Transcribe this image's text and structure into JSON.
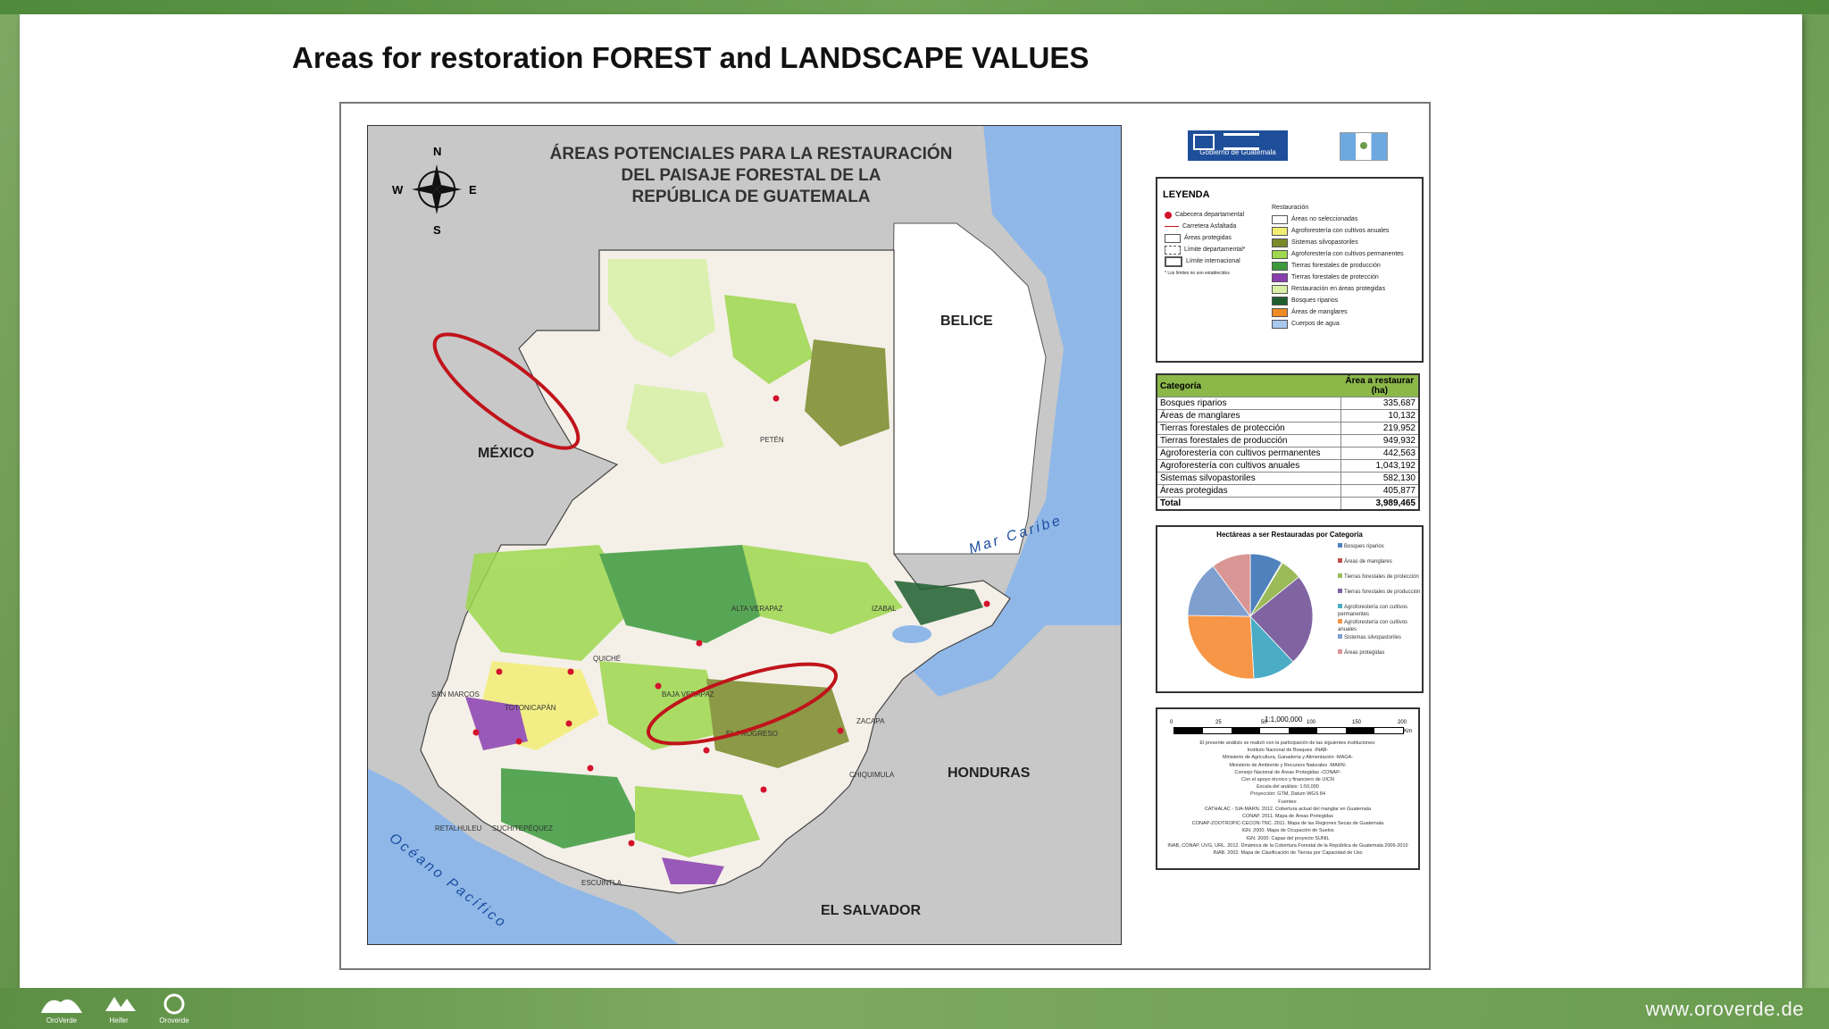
{
  "slide": {
    "title": "Areas for restoration FOREST and LANDSCAPE VALUES",
    "footer_url": "www.oroverde.de"
  },
  "map": {
    "title_lines": [
      "ÁREAS POTENCIALES PARA LA RESTAURACIÓN",
      "DEL PAISAJE FORESTAL DE LA",
      "REPÚBLICA DE GUATEMALA"
    ],
    "compass": {
      "n": "N",
      "s": "S",
      "e": "E",
      "w": "W"
    },
    "country_labels": {
      "mexico": "MÉXICO",
      "belice": "BELICE",
      "honduras": "HONDURAS",
      "el_salvador": "EL SALVADOR"
    },
    "sea_labels": {
      "caribe": "Mar Caribe",
      "pacifico": "Océano Pacífico"
    },
    "department_labels": {
      "peten": "PETÉN",
      "alta_verapaz": "ALTA VERAPAZ",
      "izabal": "IZABAL",
      "quiche": "QUICHÉ",
      "baja_verapaz": "BAJA VERAPAZ",
      "el_progreso": "EL PROGRESO",
      "zacapa": "ZACAPA",
      "san_marcos": "SAN MARCOS",
      "totonicapan": "TOTONICAPÁN",
      "escuintla": "ESCUINTLA",
      "retalhuleu": "RETALHULEU",
      "suchitepequez": "SUCHITEPÉQUEZ",
      "chiquimula": "CHIQUIMULA"
    }
  },
  "colors": {
    "sea": "#8fb8e8",
    "neighbor": "#c8c8c8",
    "guatemala_land": "#f4f0e8",
    "highlight_ellipse": "#c0141b",
    "table_header": "#8cb84a"
  },
  "legend": {
    "title": "LEYENDA",
    "left_items": [
      "Cabecera departamental",
      "Carretera Asfaltada",
      "Áreas protegidas",
      "Límite departamental*",
      "Límite internacional",
      "* Los límites no son establecidos"
    ],
    "right_header": "Restauración",
    "right_items": [
      {
        "label": "Áreas no seleccionadas",
        "color": "#ffffff"
      },
      {
        "label": "Agroforestería con cultivos anuales",
        "color": "#f2ee74"
      },
      {
        "label": "Sistemas silvopastoriles",
        "color": "#7a8a2a"
      },
      {
        "label": "Agroforestería con cultivos permanentes",
        "color": "#9ed84e"
      },
      {
        "label": "Tierras forestales de producción",
        "color": "#3c9a3c"
      },
      {
        "label": "Tierras forestales de protección",
        "color": "#8a3fb0"
      },
      {
        "label": "Restauración en áreas protegidas",
        "color": "#d7f0a6"
      },
      {
        "label": "Bosques riparios",
        "color": "#1f5f2f"
      },
      {
        "label": "Áreas de manglares",
        "color": "#f08a24"
      },
      {
        "label": "Cuerpos de agua",
        "color": "#a9c8f0"
      }
    ]
  },
  "table": {
    "header_category": "Categoría",
    "header_area": "Área a restaurar (ha)",
    "rows": [
      {
        "cat": "Bosques riparios",
        "val": "335,687"
      },
      {
        "cat": "Áreas de manglares",
        "val": "10,132"
      },
      {
        "cat": "Tierras forestales de protección",
        "val": "219,952"
      },
      {
        "cat": "Tierras forestales de producción",
        "val": "949,932"
      },
      {
        "cat": "Agroforestería con cultivos permanentes",
        "val": "442,563"
      },
      {
        "cat": "Agroforestería con cultivos anuales",
        "val": "1,043,192"
      },
      {
        "cat": "Sistemas silvopastoriles",
        "val": "582,130"
      },
      {
        "cat": "Áreas protegidas",
        "val": "405,877"
      }
    ],
    "total_label": "Total",
    "total_value": "3,989,465"
  },
  "chart_data": {
    "type": "pie",
    "title": "Hectáreas a ser Restauradas por Categoría",
    "categories": [
      "Bosques riparios",
      "Áreas de manglares",
      "Tierras forestales de protección",
      "Tierras forestales de producción",
      "Agroforestería con cultivos permanentes",
      "Agroforestería con cultivos anuales",
      "Sistemas silvopastoriles",
      "Áreas protegidas"
    ],
    "values": [
      335687,
      10132,
      219952,
      949932,
      442563,
      1043192,
      582130,
      405877
    ],
    "colors": [
      "#4f81bd",
      "#c0504d",
      "#9bbb59",
      "#8064a2",
      "#4bacc6",
      "#f79646",
      "#7f9fcf",
      "#d99694"
    ],
    "legend_position": "right"
  },
  "scale": {
    "ratio": "1:1,000,000",
    "ticks": [
      "0",
      "25",
      "50",
      "100",
      "150",
      "200"
    ],
    "unit": "Km"
  },
  "credits": [
    "El presente análisis se realizó con la participación de las siguientes instituciones:",
    "Instituto Nacional de Bosques -INAB-",
    "Ministerio de Agricultura, Ganadería y Alimentación -MAGA-",
    "Ministerio de Ambiente y Recursos Naturales -MARN-",
    "Consejo Nacional de Áreas Protegidas -CONAP-",
    "Con el apoyo técnico y financiero de UICN",
    "Escala del análisis: 1:50,000",
    "Proyección: GTM, Datum WGS 84",
    "Fuentes:",
    "CATHALAC - SIA-MARN. 2012. Cobertura actual del manglar en Guatemala",
    "CONAP. 2011. Mapa de Áreas Protegidas",
    "CONAP-ZOOTROPIC-CECON-TNC. 2011. Mapa de las Regiones Secas de Guatemala",
    "IGN. 2000. Mapa de Ocupación de Suelos",
    "IGN. 2000. Capas del proyecto SUNIL",
    "INAB, CONAP, UVG, URL. 2012. Dinámica de la Cobertura Forestal de la República de Guatemala 2006-2010",
    "INAB. 2002. Mapa de Clasificación de Tierras por Capacidad de Uso"
  ],
  "footer_logos": [
    "OroVerde",
    "Heifer",
    "Oroverde"
  ]
}
